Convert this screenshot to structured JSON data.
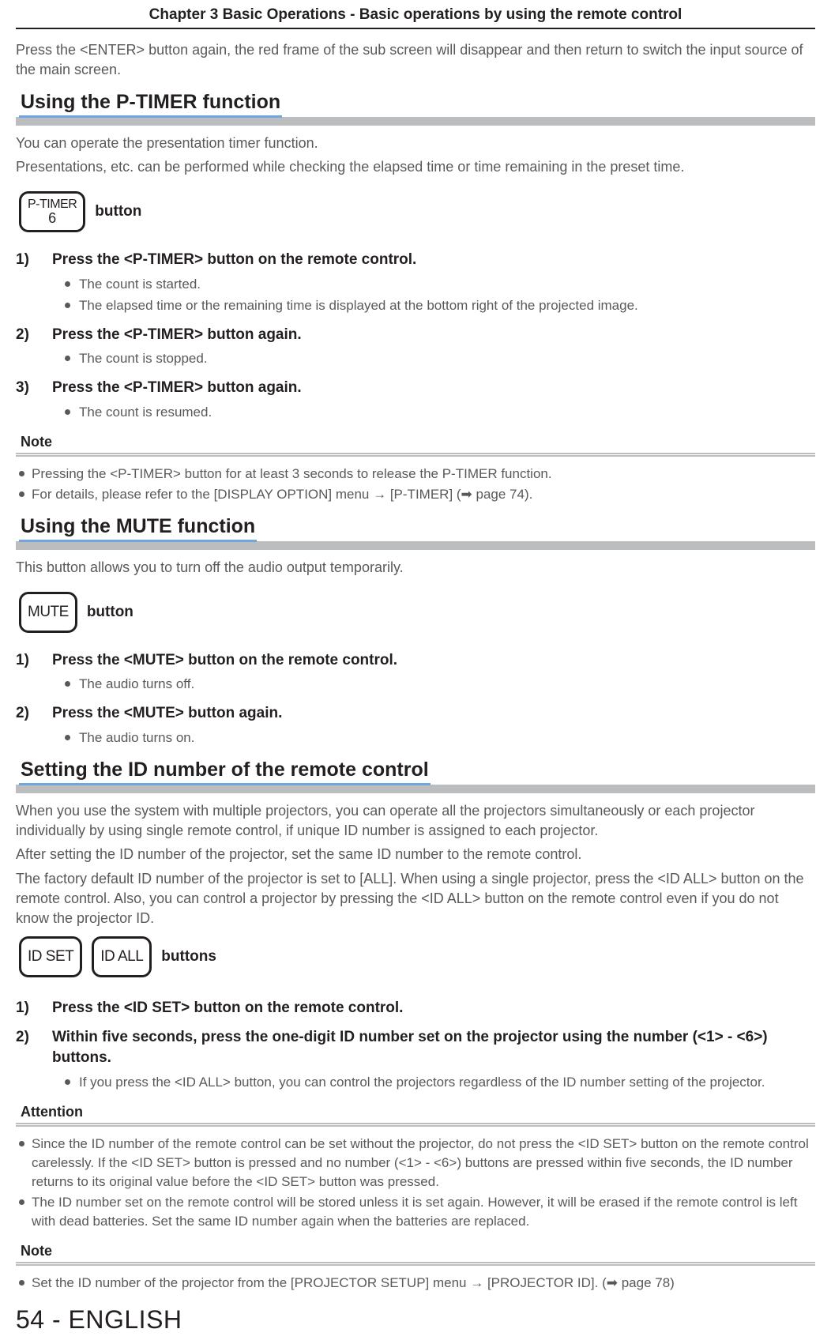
{
  "runningHead": "Chapter 3   Basic Operations - Basic operations by using the remote control",
  "introPara": "Press the <ENTER> button again, the red frame of the sub screen will disappear and then return to switch the input source of the main screen.",
  "s1": {
    "heading": "Using the P-TIMER function",
    "para1": "You can operate the presentation timer function.",
    "para2": "Presentations, etc. can be performed while checking the elapsed time or time remaining in the preset time.",
    "button": {
      "line1": "P-TIMER",
      "line2": "6",
      "label": "button"
    },
    "steps": [
      {
        "num": "1)",
        "text": "Press the <P-TIMER> button on the remote control.",
        "sub": [
          "The count is started.",
          "The elapsed time or the remaining time is displayed at the bottom right of the projected image."
        ]
      },
      {
        "num": "2)",
        "text": "Press the <P-TIMER> button again.",
        "sub": [
          "The count is stopped."
        ]
      },
      {
        "num": "3)",
        "text": "Press the <P-TIMER> button again.",
        "sub": [
          "The count is resumed."
        ]
      }
    ],
    "noteHead": "Note",
    "notes": [
      "Pressing the <P-TIMER> button for at least 3 seconds to release the P-TIMER function.",
      "For details, please refer to the [DISPLAY OPTION] menu → [P-TIMER] (➡ page 74)."
    ]
  },
  "s2": {
    "heading": "Using the MUTE function",
    "para1": "This button allows you to turn off the audio output temporarily.",
    "button": {
      "line1": "MUTE",
      "label": "button"
    },
    "steps": [
      {
        "num": "1)",
        "text": "Press the <MUTE> button on the remote control.",
        "sub": [
          "The audio turns off."
        ]
      },
      {
        "num": "2)",
        "text": "Press the <MUTE> button again.",
        "sub": [
          "The audio turns on."
        ]
      }
    ]
  },
  "s3": {
    "heading": "Setting the ID number of the remote control",
    "para1": "When you use the system with multiple projectors, you can operate all the projectors simultaneously or each projector individually by using single remote control, if unique ID number is assigned to each projector.",
    "para2": "After setting the ID number of the projector, set the same ID number to the remote control.",
    "para3": "The factory default ID number of the projector is set to [ALL]. When using a single projector, press the <ID ALL> button on the remote control. Also, you can control a projector by pressing the <ID ALL> button on the remote control even if you do not know the projector ID.",
    "buttons": {
      "b1": "ID SET",
      "b2": "ID ALL",
      "label": "buttons"
    },
    "steps": [
      {
        "num": "1)",
        "text": "Press the <ID SET> button on the remote control.",
        "sub": []
      },
      {
        "num": "2)",
        "text": "Within five seconds, press the one-digit ID number set on the projector using the number (<1> - <6>) buttons.",
        "sub": [
          "If you press the <ID ALL> button, you can control the projectors regardless of the ID number setting of the projector."
        ]
      }
    ],
    "attentionHead": "Attention",
    "attention": [
      "Since the ID number of the remote control can be set without the projector, do not press the <ID SET> button on the remote control carelessly. If the <ID SET> button is pressed and no number (<1> - <6>) buttons are pressed within five seconds, the ID number returns to its original value before the <ID SET> button was pressed.",
      "The ID number set on the remote control will be stored unless it is set again. However, it will be erased if the remote control is left with dead batteries. Set the same ID number again when the batteries are replaced."
    ],
    "noteHead": "Note",
    "notes": [
      "Set the ID number of the projector from the [PROJECTOR SETUP] menu → [PROJECTOR ID]. (➡ page 78)"
    ]
  },
  "footer": "54 - ENGLISH"
}
